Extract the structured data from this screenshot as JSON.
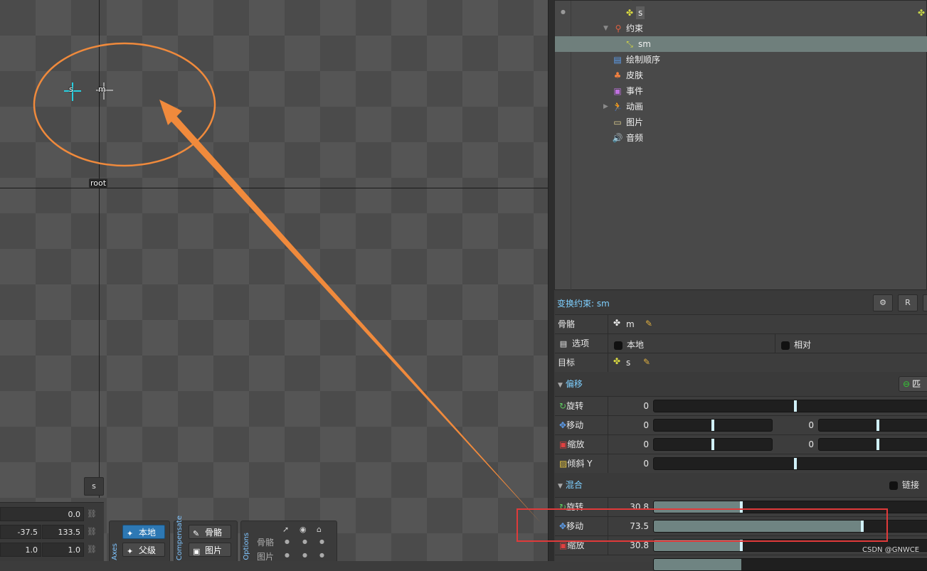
{
  "viewport": {
    "bones": {
      "s": "s",
      "m": "m",
      "root": "root"
    },
    "selected_button": "s",
    "transform_rows": [
      {
        "a": "",
        "b": "0.0"
      },
      {
        "a": "-37.5",
        "b": "133.5"
      },
      {
        "a": "1.0",
        "b": "1.0"
      }
    ],
    "axes": {
      "label": "Axes",
      "local": "本地",
      "parent": "父级"
    },
    "compensate": {
      "label": "Compensate",
      "bones": "骨骼",
      "images": "图片"
    },
    "options": {
      "label": "Options",
      "bones": "骨骼",
      "images": "图片"
    }
  },
  "tree": {
    "items": [
      {
        "label": "",
        "icon": "bone-icon"
      },
      {
        "label": "s",
        "icon": "bone-icon"
      },
      {
        "label": "约束",
        "icon": "constraint-icon"
      },
      {
        "label": "sm",
        "icon": "transform-constraint-icon"
      },
      {
        "label": "绘制顺序",
        "icon": "draw-order-icon"
      },
      {
        "label": "皮肤",
        "icon": "skin-icon"
      },
      {
        "label": "事件",
        "icon": "event-icon"
      },
      {
        "label": "动画",
        "icon": "animation-icon"
      },
      {
        "label": "图片",
        "icon": "images-icon"
      },
      {
        "label": "音频",
        "icon": "audio-icon"
      }
    ]
  },
  "properties": {
    "title": "变换约束: sm",
    "bone": {
      "label": "骨骼",
      "value": "m"
    },
    "options": {
      "label": "选项",
      "local": "本地",
      "relative": "相对"
    },
    "target": {
      "label": "目标",
      "value": "s"
    },
    "offset": {
      "section": "偏移",
      "match_button": "匹",
      "rotate": {
        "label": "旋转",
        "value": "0",
        "level": 0.5
      },
      "translate": {
        "label": "移动",
        "x": "0",
        "y": "0",
        "x_level": 0.5,
        "y_level": 0.5
      },
      "scale": {
        "label": "缩放",
        "x": "0",
        "y": "0",
        "x_level": 0.5,
        "y_level": 0.5
      },
      "shear": {
        "label": "倾斜 Y",
        "value": "0",
        "level": 0.5
      }
    },
    "mix": {
      "section": "混合",
      "chain": "链接滑",
      "rotate": {
        "label": "旋转",
        "value": "30.8",
        "level": 0.308
      },
      "translate": {
        "label": "移动",
        "value": "73.5",
        "level": 0.735
      },
      "scale": {
        "label": "缩放",
        "value": "30.8",
        "level": 0.308
      }
    }
  },
  "watermark": "CSDN @GNWCE",
  "colors": {
    "accent": "#7fd0ff",
    "annotation_orange": "#f08a3c",
    "annotation_red": "#e03a3a",
    "selected_row": "#6f7f7c"
  }
}
